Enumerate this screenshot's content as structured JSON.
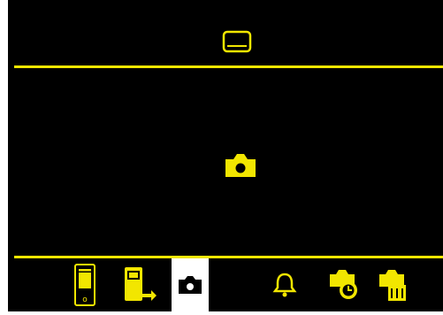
{
  "screen": {
    "background": "#000000",
    "accent": "#f2e600",
    "active_tile": "#ffffff"
  },
  "header": {
    "icon": "screen-icon"
  },
  "viewer": {
    "icon": "camera-icon"
  },
  "toolbar": {
    "items": [
      {
        "icon": "device-capture-icon",
        "active": false
      },
      {
        "icon": "device-export-icon",
        "active": false
      },
      {
        "icon": "camera-icon",
        "active": true
      },
      {
        "icon": "bell-icon",
        "active": false
      },
      {
        "icon": "camera-timer-icon",
        "active": false
      },
      {
        "icon": "camera-delete-icon",
        "active": false
      }
    ]
  }
}
